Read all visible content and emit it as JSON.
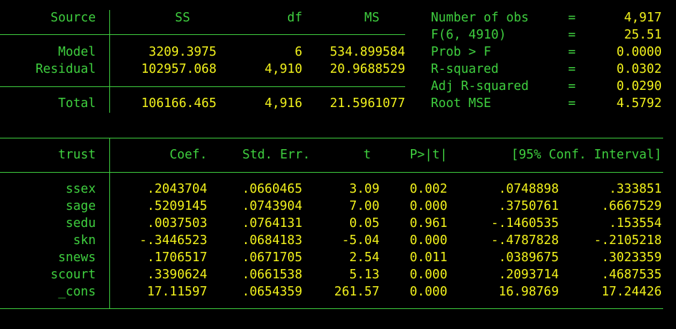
{
  "anova": {
    "headers": {
      "source": "Source",
      "ss": "SS",
      "df": "df",
      "ms": "MS"
    },
    "rows": [
      {
        "source": "Model",
        "ss": "3209.3975",
        "df": "6",
        "ms": "534.899584"
      },
      {
        "source": "Residual",
        "ss": "102957.068",
        "df": "4,910",
        "ms": "20.9688529"
      }
    ],
    "total": {
      "source": "Total",
      "ss": "106166.465",
      "df": "4,916",
      "ms": "21.5961077"
    }
  },
  "stats": [
    {
      "label": "Number of obs",
      "eq": "=",
      "value": "4,917"
    },
    {
      "label": "F(6, 4910)",
      "eq": "=",
      "value": "25.51"
    },
    {
      "label": "Prob > F",
      "eq": "=",
      "value": "0.0000"
    },
    {
      "label": "R-squared",
      "eq": "=",
      "value": "0.0302"
    },
    {
      "label": "Adj R-squared",
      "eq": "=",
      "value": "0.0290"
    },
    {
      "label": "Root MSE",
      "eq": "=",
      "value": "4.5792"
    }
  ],
  "coef_table": {
    "headers": {
      "var": "trust",
      "coef": "Coef.",
      "se": "Std. Err.",
      "t": "t",
      "p": "P>|t|",
      "ci": "[95% Conf. Interval]"
    },
    "rows": [
      {
        "var": "ssex",
        "coef": ".2043704",
        "se": ".0660465",
        "t": "3.09",
        "p": "0.002",
        "lo": ".0748898",
        "hi": ".333851"
      },
      {
        "var": "sage",
        "coef": ".5209145",
        "se": ".0743904",
        "t": "7.00",
        "p": "0.000",
        "lo": ".3750761",
        "hi": ".6667529"
      },
      {
        "var": "sedu",
        "coef": ".0037503",
        "se": ".0764131",
        "t": "0.05",
        "p": "0.961",
        "lo": "-.1460535",
        "hi": ".153554"
      },
      {
        "var": "skn",
        "coef": "-.3446523",
        "se": ".0684183",
        "t": "-5.04",
        "p": "0.000",
        "lo": "-.4787828",
        "hi": "-.2105218"
      },
      {
        "var": "snews",
        "coef": ".1706517",
        "se": ".0671705",
        "t": "2.54",
        "p": "0.011",
        "lo": ".0389675",
        "hi": ".3023359"
      },
      {
        "var": "scourt",
        "coef": ".3390624",
        "se": ".0661538",
        "t": "5.13",
        "p": "0.000",
        "lo": ".2093714",
        "hi": ".4687535"
      },
      {
        "var": "_cons",
        "coef": "17.11597",
        "se": ".0654359",
        "t": "261.57",
        "p": "0.000",
        "lo": "16.98769",
        "hi": "17.24426"
      }
    ]
  },
  "colors": {
    "label": "#3fcf3f",
    "value": "#f2f21c",
    "background": "#000000"
  }
}
